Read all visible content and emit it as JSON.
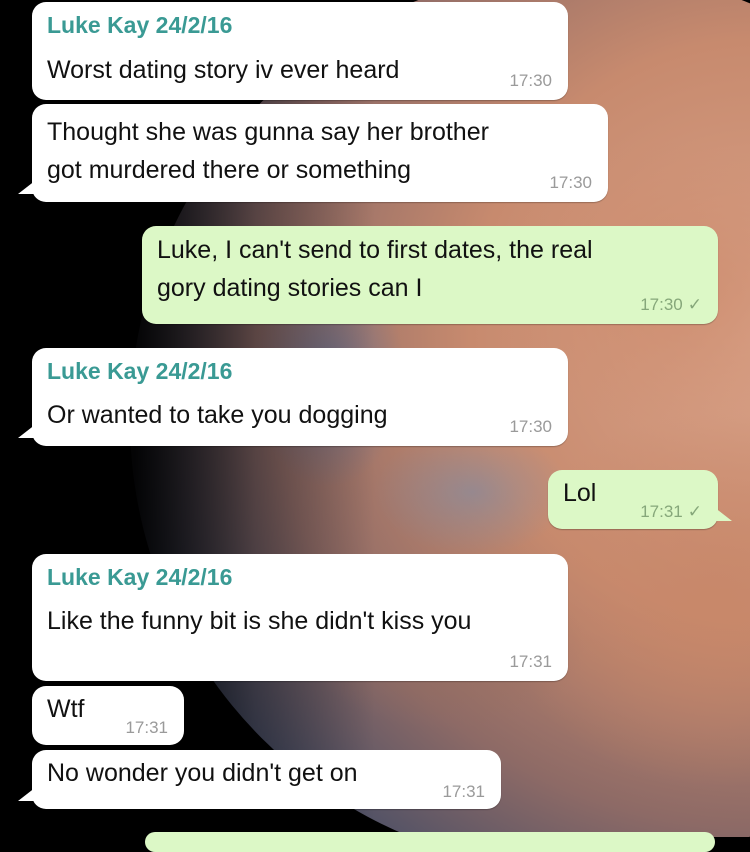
{
  "chat": {
    "messages": [
      {
        "sender": "Luke Kay 24/2/16",
        "text": "Worst dating story iv ever heard",
        "time": "17:30"
      },
      {
        "text": "Thought she was gunna say her brother\ngot murdered there or something",
        "time": "17:30"
      },
      {
        "text": "Luke, I can't send to first dates, the real\ngory dating stories can I",
        "time": "17:30",
        "status_icon": "single-check-icon"
      },
      {
        "sender": "Luke Kay 24/2/16",
        "text": "Or wanted to take you dogging",
        "time": "17:30"
      },
      {
        "text": "Lol",
        "time": "17:31",
        "status_icon": "single-check-icon"
      },
      {
        "sender": "Luke Kay 24/2/16",
        "text": "Like the funny bit is she didn't kiss you",
        "time": "17:31"
      },
      {
        "text": "Wtf",
        "time": "17:31"
      },
      {
        "text": "No wonder you didn't get on",
        "time": "17:31"
      }
    ]
  },
  "icons": {
    "check": "✓"
  },
  "colors": {
    "incoming_bubble": "#ffffff",
    "outgoing_bubble": "#dcf8c6",
    "sender_name": "#3a9a94"
  }
}
